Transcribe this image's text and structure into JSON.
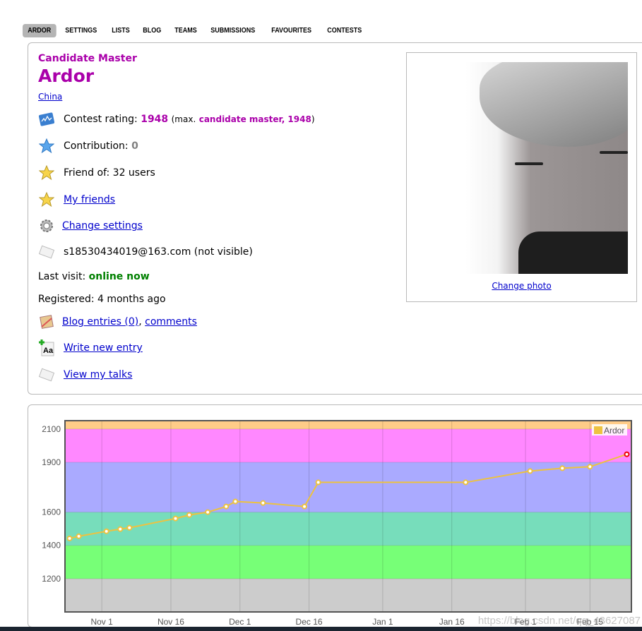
{
  "nav": {
    "tabs": [
      {
        "label": "ARDOR",
        "active": true
      },
      {
        "label": "SETTINGS"
      },
      {
        "label": "LISTS"
      },
      {
        "label": "BLOG"
      },
      {
        "label": "TEAMS"
      },
      {
        "label": "SUBMISSIONS"
      },
      {
        "label": "FAVOURITES"
      },
      {
        "label": "CONTESTS"
      }
    ]
  },
  "profile": {
    "rank": "Candidate Master",
    "handle": "Ardor",
    "country": "China",
    "rating_label": "Contest rating:",
    "rating": "1948",
    "max_open": "(max.",
    "max_rank": "candidate master, 1948",
    "max_close": ")",
    "contribution_label": "Contribution:",
    "contribution": "0",
    "friend_of": "Friend of: 32 users",
    "my_friends": "My friends",
    "change_settings": "Change settings",
    "email": "s18530434019@163.com (not visible)",
    "last_visit_label": "Last visit:",
    "last_visit": "online now",
    "registered": "Registered: 4 months ago",
    "blog_entries": "Blog entries (0)",
    "comma": ",",
    "comments": "comments",
    "write_entry": "Write new entry",
    "view_talks": "View my talks",
    "change_photo": "Change photo",
    "colors": {
      "rank": "#aa00aa",
      "online": "#008000",
      "link": "#0000cc"
    }
  },
  "chart_data": {
    "type": "line",
    "legend": "Ardor",
    "legend_position": "top-right",
    "ylim": [
      1000,
      2150
    ],
    "xlim": [
      "2019-10-24",
      "2020-02-24"
    ],
    "yticks": [
      1200,
      1400,
      1600,
      1900,
      2100
    ],
    "xticks": [
      {
        "date": "2019-11-01",
        "label": "Nov 1"
      },
      {
        "date": "2019-11-16",
        "label": "Nov 16"
      },
      {
        "date": "2019-12-01",
        "label": "Dec 1"
      },
      {
        "date": "2019-12-16",
        "label": "Dec 16"
      },
      {
        "date": "2020-01-01",
        "label": "Jan 1"
      },
      {
        "date": "2020-01-16",
        "label": "Jan 16"
      },
      {
        "date": "2020-02-01",
        "label": "Feb 1"
      },
      {
        "date": "2020-02-15",
        "label": "Feb 15"
      }
    ],
    "bands": [
      {
        "from": 1000,
        "to": 1200,
        "color": "#cccccc"
      },
      {
        "from": 1200,
        "to": 1400,
        "color": "#77ff77"
      },
      {
        "from": 1400,
        "to": 1600,
        "color": "#77ddbb"
      },
      {
        "from": 1600,
        "to": 1900,
        "color": "#aaaaff"
      },
      {
        "from": 1900,
        "to": 2100,
        "color": "#ff88ff"
      },
      {
        "from": 2100,
        "to": 2150,
        "color": "#ffcc88"
      }
    ],
    "line_color": "#edc240",
    "points": [
      [
        "2019-10-25",
        1442
      ],
      [
        "2019-10-27",
        1455
      ],
      [
        "2019-11-02",
        1485
      ],
      [
        "2019-11-05",
        1498
      ],
      [
        "2019-11-07",
        1506
      ],
      [
        "2019-11-17",
        1562
      ],
      [
        "2019-11-20",
        1583
      ],
      [
        "2019-11-24",
        1600
      ],
      [
        "2019-11-28",
        1634
      ],
      [
        "2019-11-30",
        1664
      ],
      [
        "2019-12-06",
        1655
      ],
      [
        "2019-12-15",
        1634
      ],
      [
        "2019-12-18",
        1779
      ],
      [
        "2020-01-19",
        1779
      ],
      [
        "2020-02-02",
        1847
      ],
      [
        "2020-02-09",
        1864
      ],
      [
        "2020-02-15",
        1873
      ],
      [
        "2020-02-23",
        1948
      ]
    ],
    "grid": true
  },
  "watermark": "https://blog.csdn.net/qq_43627087"
}
